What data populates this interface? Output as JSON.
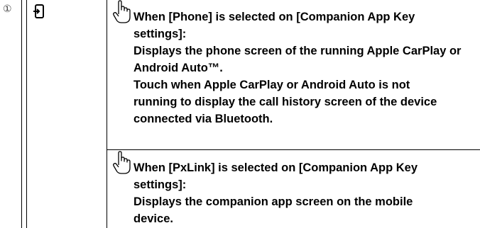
{
  "row_number": "①",
  "icon_name": "phone-login-icon",
  "hand_icon_name": "touch-hand-icon",
  "blocks": [
    {
      "lines": [
        "When [Phone] is selected on [Companion App Key",
        "settings]:",
        "Displays the phone screen of the running Apple CarPlay or",
        "Android Auto™.",
        "Touch when Apple CarPlay or Android Auto is not",
        "running to display the call history screen of the device",
        "connected via Bluetooth."
      ]
    },
    {
      "lines": [
        "When [PxLink] is selected on [Companion App Key",
        "settings]:",
        "Displays the companion app screen on the mobile",
        "device."
      ]
    }
  ]
}
